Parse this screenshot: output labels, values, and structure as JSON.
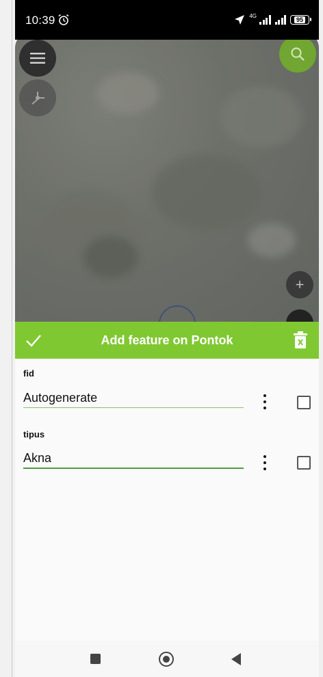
{
  "status_bar": {
    "time": "10:39",
    "network_label": "4G",
    "battery_level": "95",
    "alarm_icon": "alarm-clock-icon",
    "location_icon": "navigation-arrow-icon"
  },
  "map": {
    "menu_icon": "hamburger-icon",
    "digitize_icon": "digitize-node-icon",
    "search_icon": "search-icon",
    "zoom_in_label": "+",
    "accent_color": "#70a631"
  },
  "form": {
    "title": "Add feature on Pontok",
    "header_color": "#80c832",
    "fields": [
      {
        "label": "fid",
        "value": "Autogenerate",
        "checked": false
      },
      {
        "label": "tipus",
        "value": "Akna",
        "checked": false
      }
    ]
  },
  "nav_bar": {
    "recents_icon": "square-icon",
    "home_icon": "circle-icon",
    "back_icon": "triangle-back-icon"
  }
}
